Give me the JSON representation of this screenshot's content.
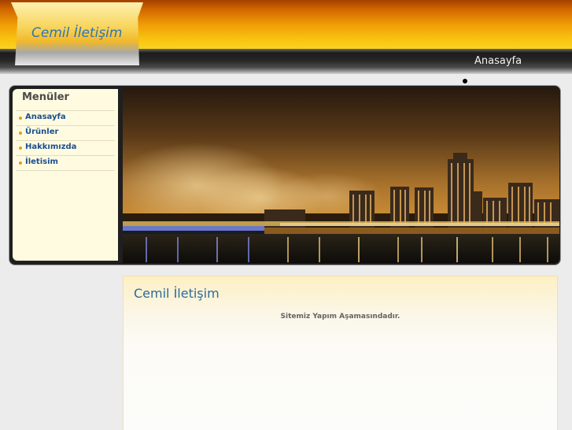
{
  "header": {
    "site_title": "Cemil İletişim",
    "nav": [
      {
        "label": "Anasayfa"
      }
    ]
  },
  "sidebar": {
    "title": "Menüler",
    "items": [
      {
        "label": "Anasayfa"
      },
      {
        "label": "Ürünler"
      },
      {
        "label": "Hakkımızda"
      },
      {
        "label": "İletisim"
      }
    ]
  },
  "banner": {
    "image": "city-skyline-night"
  },
  "content": {
    "title": "Cemil İletişim",
    "message": "Sitemiz Yapım Aşamasındadır."
  },
  "colors": {
    "header_orange": "#f8c110",
    "header_dark": "#1b1b1b",
    "link_blue": "#1c4f8e",
    "title_blue": "#2d6a9c",
    "menu_background": "#fffbe1",
    "bullet_orange": "#e89a1c"
  }
}
